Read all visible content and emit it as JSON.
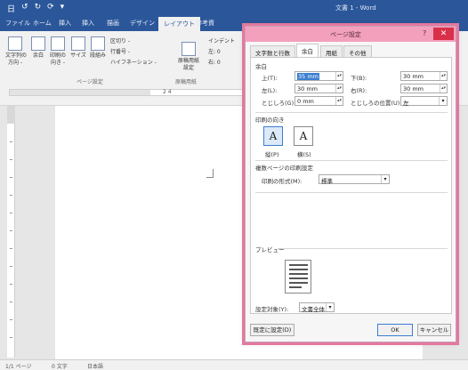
{
  "word": {
    "qat": [
      "日",
      "↺",
      "↻",
      "⟳",
      "▾"
    ],
    "title": "文書 1 - Word",
    "tabs": [
      "ファイル",
      "ホーム",
      "挿入",
      "挿入",
      "描画",
      "デザイン",
      "レイアウト",
      "参考資"
    ],
    "active_tab_index": 6,
    "ribbon": {
      "buttons": [
        {
          "label": "文字列の\n方向 -"
        },
        {
          "label": "余白"
        },
        {
          "label": "印刷の\n向き -"
        },
        {
          "label": "サイズ"
        },
        {
          "label": "段組み"
        },
        {
          "label": "原稿用紙\n設定"
        }
      ],
      "small_items": [
        "区切り -",
        "行番号 -",
        "ハイフネーション -",
        "インデント",
        "左: 0",
        "右: 0"
      ],
      "group_labels": [
        "ページ設定",
        "原稿用紙"
      ]
    },
    "ruler_numbers": "2   4",
    "status": {
      "page": "1/1 ページ",
      "words": "0 文字",
      "language": "日本語"
    }
  },
  "dialog": {
    "title": "ページ設定",
    "help": "?",
    "close": "✕",
    "tabs": [
      "文字数と行数",
      "余白",
      "用紙",
      "その他"
    ],
    "active_tab_index": 1,
    "margins": {
      "section": "余白",
      "top": {
        "label": "上(T):",
        "value": "35 mm"
      },
      "bottom": {
        "label": "下(B):",
        "value": "30 mm"
      },
      "left": {
        "label": "左(L):",
        "value": "30 mm"
      },
      "right": {
        "label": "右(R):",
        "value": "30 mm"
      },
      "gutter": {
        "label": "とじしろ(G):",
        "value": "0 mm"
      },
      "gutter_position": {
        "label": "とじしろの位置(U):",
        "value": "左"
      }
    },
    "orientation": {
      "section": "印刷の向き",
      "portrait": {
        "glyph": "A",
        "label": "縦(P)"
      },
      "landscape": {
        "glyph": "A",
        "label": "横(S)"
      },
      "selected": "portrait"
    },
    "multiple_pages": {
      "section": "複数ページの印刷設定",
      "label": "印刷の形式(M):",
      "value": "標準"
    },
    "preview": {
      "section": "プレビュー"
    },
    "apply_to": {
      "label": "設定対象(Y):",
      "value": "文書全体"
    },
    "buttons": {
      "default": "既定に設定(D)",
      "ok": "OK",
      "cancel": "キャンセル"
    }
  },
  "colors": {
    "word_blue": "#2b579a",
    "dialog_highlight": "#e4789e",
    "close_red": "#d9304a",
    "selection_blue": "#3c7fd1"
  }
}
